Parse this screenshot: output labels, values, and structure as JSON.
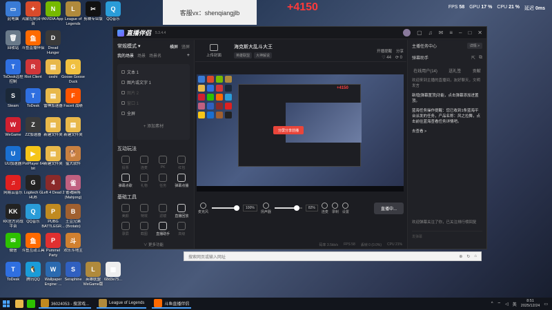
{
  "watermark": "客服vx：shenqiangjlb",
  "overlay_counter": "+4150",
  "system_stats": {
    "fps_label": "FPS",
    "fps": "58",
    "gpu_label": "GPU",
    "gpu": "17 %",
    "cpu_label": "CPU",
    "cpu": "21 %",
    "latency_label": "延迟",
    "latency": "0ms"
  },
  "desktop_icons": [
    {
      "label": "此电脑",
      "color": "#3a7bd5",
      "glyph": "▭"
    },
    {
      "label": "鸿蒙控制台平台",
      "color": "#d94b2b",
      "glyph": "✦"
    },
    {
      "label": "NVIDIA App",
      "color": "#76b900",
      "glyph": "N"
    },
    {
      "label": "League of Legends",
      "color": "#b08a3c",
      "glyph": "L"
    },
    {
      "label": "剪映专业版",
      "color": "#111111",
      "glyph": "✂"
    },
    {
      "label": "QQ音乐",
      "color": "#2a9cd8",
      "glyph": "Q"
    },
    {
      "label": "回收站",
      "color": "#6a7a8a",
      "glyph": "🗑"
    },
    {
      "label": "斗鱼直播伴侣",
      "color": "#ff6a00",
      "glyph": "鱼"
    },
    {
      "label": "Dread Hunger",
      "color": "#3a3a3a",
      "glyph": "D"
    },
    {
      "label": "",
      "color": "transparent",
      "glyph": ""
    },
    {
      "label": "",
      "color": "transparent",
      "glyph": ""
    },
    {
      "label": "",
      "color": "transparent",
      "glyph": ""
    },
    {
      "label": "ToDesk远程控制",
      "color": "#2f6fe0",
      "glyph": "T"
    },
    {
      "label": "Riot Client",
      "color": "#d13639",
      "glyph": "R"
    },
    {
      "label": "ceshi",
      "color": "#e8b84a",
      "glyph": "▤"
    },
    {
      "label": "Goose Goose Duck",
      "color": "#f0c040",
      "glyph": "G"
    },
    {
      "label": "",
      "color": "transparent",
      "glyph": ""
    },
    {
      "label": "",
      "color": "transparent",
      "glyph": ""
    },
    {
      "label": "Steam",
      "color": "#1b2838",
      "glyph": "S"
    },
    {
      "label": "ToDesk",
      "color": "#2f6fe0",
      "glyph": "T"
    },
    {
      "label": "雷神加速器",
      "color": "#e8b84a",
      "glyph": "▤"
    },
    {
      "label": "Faceit 战绩",
      "color": "#ff5500",
      "glyph": "F"
    },
    {
      "label": "",
      "color": "transparent",
      "glyph": ""
    },
    {
      "label": "",
      "color": "transparent",
      "glyph": ""
    },
    {
      "label": "WeGame",
      "color": "#d02030",
      "glyph": "W"
    },
    {
      "label": "ZZ加速器",
      "color": "#3a3a3a",
      "glyph": "Z"
    },
    {
      "label": "新建文件夹",
      "color": "#e8b84a",
      "glyph": "▤"
    },
    {
      "label": "新建文件夹",
      "color": "#e8b84a",
      "glyph": "▤"
    },
    {
      "label": "",
      "color": "transparent",
      "glyph": ""
    },
    {
      "label": "",
      "color": "transparent",
      "glyph": ""
    },
    {
      "label": "UU加速器",
      "color": "#1a6fd0",
      "glyph": "U"
    },
    {
      "label": "PotPlayer 64 bit",
      "color": "#f5c518",
      "glyph": "▶"
    },
    {
      "label": "新建文件夹",
      "color": "#e8b84a",
      "glyph": "▤"
    },
    {
      "label": "猛犬软件",
      "color": "#c88040",
      "glyph": "🐕"
    },
    {
      "label": "",
      "color": "transparent",
      "glyph": ""
    },
    {
      "label": "",
      "color": "transparent",
      "glyph": ""
    },
    {
      "label": "网易云音乐",
      "color": "#e02020",
      "glyph": "♫"
    },
    {
      "label": "Logitech G HUB",
      "color": "#222222",
      "glyph": "G"
    },
    {
      "label": "Left 4 Dead 2",
      "color": "#8a2a2a",
      "glyph": "4"
    },
    {
      "label": "雀魂麻将 (Mahjong)",
      "color": "#c06080",
      "glyph": "雀"
    },
    {
      "label": "",
      "color": "transparent",
      "glyph": ""
    },
    {
      "label": "",
      "color": "transparent",
      "glyph": ""
    },
    {
      "label": "KK官方对战平台",
      "color": "#222222",
      "glyph": "KK"
    },
    {
      "label": "QQ音乐",
      "color": "#2a9cd8",
      "glyph": "Q"
    },
    {
      "label": "PUBG BATTLEGR...",
      "color": "#c08a20",
      "glyph": "P"
    },
    {
      "label": "土豆兄弟 (Brotato)",
      "color": "#a06030",
      "glyph": "B"
    },
    {
      "label": "",
      "color": "transparent",
      "glyph": ""
    },
    {
      "label": "",
      "color": "transparent",
      "glyph": ""
    },
    {
      "label": "微信",
      "color": "#2dc100",
      "glyph": "✉"
    },
    {
      "label": "斗鱼互动工具",
      "color": "#ff6a00",
      "glyph": "鱼"
    },
    {
      "label": "Pummel Party",
      "color": "#e03030",
      "glyph": "P"
    },
    {
      "label": "欢乐斗地主",
      "color": "#d08030",
      "glyph": "斗"
    },
    {
      "label": "",
      "color": "transparent",
      "glyph": ""
    },
    {
      "label": "",
      "color": "transparent",
      "glyph": ""
    },
    {
      "label": "ToDesk",
      "color": "#2f6fe0",
      "glyph": "T"
    },
    {
      "label": "腾讯QQ",
      "color": "#1a9cd8",
      "glyph": "🐧"
    },
    {
      "label": "Wallpaper Engine: ...",
      "color": "#2a6ab0",
      "glyph": "W"
    },
    {
      "label": "Seraphine",
      "color": "#3060c0",
      "glyph": "S"
    },
    {
      "label": "英雄联盟WeGame版",
      "color": "#b08a3c",
      "glyph": "L"
    },
    {
      "label": "68d3e75...",
      "color": "#eeeeee",
      "glyph": "▦"
    }
  ],
  "app": {
    "brand": "直播伴侣",
    "version": "5.3.4.4",
    "left": {
      "mode_title": "常规模式 ▾",
      "tabs": [
        "横屏",
        "竖屏"
      ],
      "scene_tabs": [
        "我的场景",
        "场景",
        "场景名"
      ],
      "scenes": [
        {
          "label": "文本 1",
          "dim": false
        },
        {
          "label": "图片或文字 1",
          "dim": false
        },
        {
          "label": "图片 2",
          "dim": true
        },
        {
          "label": "窗口 1",
          "dim": true
        },
        {
          "label": "全屏",
          "dim": false
        }
      ],
      "add_source": "+ 添加素材",
      "interact_title": "互动玩法",
      "interact_tools": [
        {
          "label": "投票",
          "on": false
        },
        {
          "label": "连麦",
          "on": false
        },
        {
          "label": "PK",
          "on": false
        },
        {
          "label": "红包",
          "on": false
        },
        {
          "label": "弹幕点歌",
          "on": true
        },
        {
          "label": "礼物",
          "on": false
        },
        {
          "label": "任务",
          "on": false
        },
        {
          "label": "弹幕点播",
          "on": true
        }
      ],
      "basic_title": "基础工具",
      "basic_tools": [
        {
          "label": "美颜",
          "on": false
        },
        {
          "label": "特效",
          "on": false
        },
        {
          "label": "滤镜",
          "on": false
        },
        {
          "label": "直播回放",
          "on": true
        },
        {
          "label": "录屏",
          "on": false
        },
        {
          "label": "截图",
          "on": false
        },
        {
          "label": "直播助手",
          "on": true
        },
        {
          "label": "高级",
          "on": false
        }
      ],
      "more": "∨ 更多功能"
    },
    "center": {
      "upload_label": "上传封面",
      "title": "海克斯大乱斗大王",
      "tags": [
        "英雄联盟",
        "大神解说"
      ],
      "top_right": [
        "开播提醒",
        "分享"
      ],
      "stats": [
        "♡ 44",
        "⟳ 0"
      ],
      "preview_red_text": "+4150",
      "preview_button": "分屏分享前播",
      "controls": {
        "mic_label": "麦克风",
        "mic_volume": "100%",
        "speaker_label": "扬声器",
        "speaker_volume": "82%",
        "buttons": [
          "连麦",
          "录制",
          "设置"
        ],
        "live_button": "直播中..."
      },
      "status": [
        "码率 3.5kb/s",
        "FPS 58",
        "丢帧 0 (0.0%)",
        "CPU 21%"
      ]
    },
    "right": {
      "task_center": "主播任务中心",
      "task_btn": "详情 >",
      "assistant_title": "弹幕助手",
      "tabs": [
        "在线用户(14)",
        "送礼签",
        "贡献"
      ],
      "messages": [
        {
          "text": "欢迎来到主播的直播间，友好聊天，文明发言",
          "bright": false
        },
        {
          "text": "新增[弹幕置顶]功能，点击弹幕添加进置顶。",
          "bright": true
        },
        {
          "text": "蓝海任务操作提醒：您已收到1条蓝海平台派发的任务，产品名称：风之拉舞，点击前往蓝海查看任务详情吧。",
          "bright": true
        },
        {
          "text": "去查看 >",
          "bright": true
        }
      ],
      "bottom_msg": "欢迎弹幕关注了你，已关注排行榜回复",
      "input_placeholder": "发弹幕"
    }
  },
  "search_strip": {
    "placeholder": "搜索网页或输入网址",
    "icons": [
      "⊕",
      "↻",
      "⌂"
    ]
  },
  "taskbar": {
    "tasks": [
      {
        "label": "36024053 - 搜游戏...",
        "color": "#c08a20"
      },
      {
        "label": "League of Legends",
        "color": "#b08a3c"
      },
      {
        "label": "斗鱼直播伴侣",
        "color": "#ff6a00"
      }
    ],
    "tray_lang": "英",
    "time": "8:51",
    "date": "2025/12/24"
  }
}
